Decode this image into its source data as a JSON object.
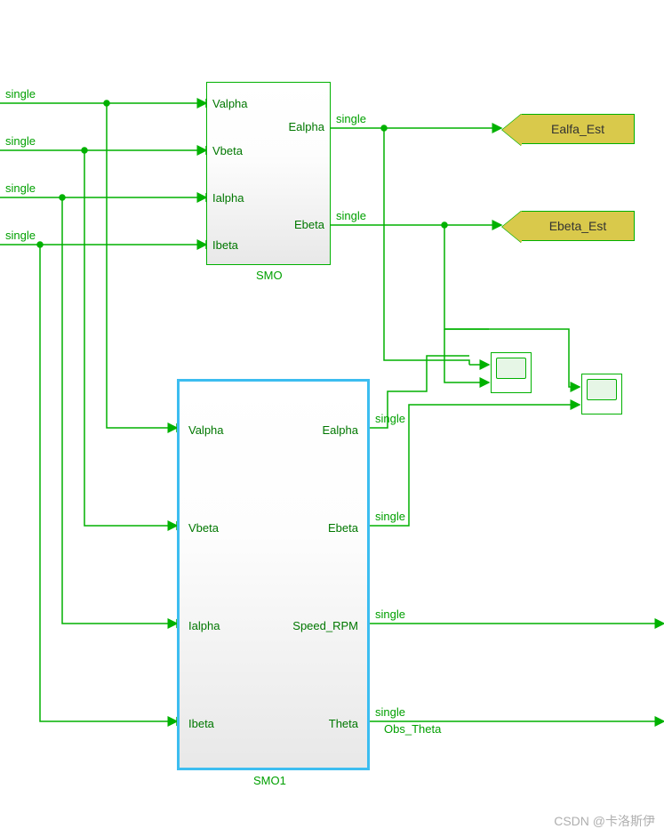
{
  "inputs": {
    "sig1": "single",
    "sig2": "single",
    "sig3": "single",
    "sig4": "single"
  },
  "smo": {
    "name": "SMO",
    "in": {
      "valpha": "Valpha",
      "vbeta": "Vbeta",
      "ialpha": "Ialpha",
      "ibeta": "Ibeta"
    },
    "out": {
      "ealpha": "Ealpha",
      "ebeta": "Ebeta"
    },
    "out_sig": {
      "ealpha": "single",
      "ebeta": "single"
    }
  },
  "smo1": {
    "name": "SMO1",
    "in": {
      "valpha": "Valpha",
      "vbeta": "Vbeta",
      "ialpha": "Ialpha",
      "ibeta": "Ibeta"
    },
    "out": {
      "ealpha": "Ealpha",
      "ebeta": "Ebeta",
      "speed": "Speed_RPM",
      "theta": "Theta"
    },
    "out_sig": {
      "ealpha": "single",
      "ebeta": "single",
      "speed": "single",
      "theta": "single"
    }
  },
  "goto": {
    "ealfa": "Ealfa_Est",
    "ebeta": "Ebeta_Est"
  },
  "extra_labels": {
    "obs_theta": "Obs_Theta"
  },
  "watermark": "CSDN @卡洛斯伊"
}
